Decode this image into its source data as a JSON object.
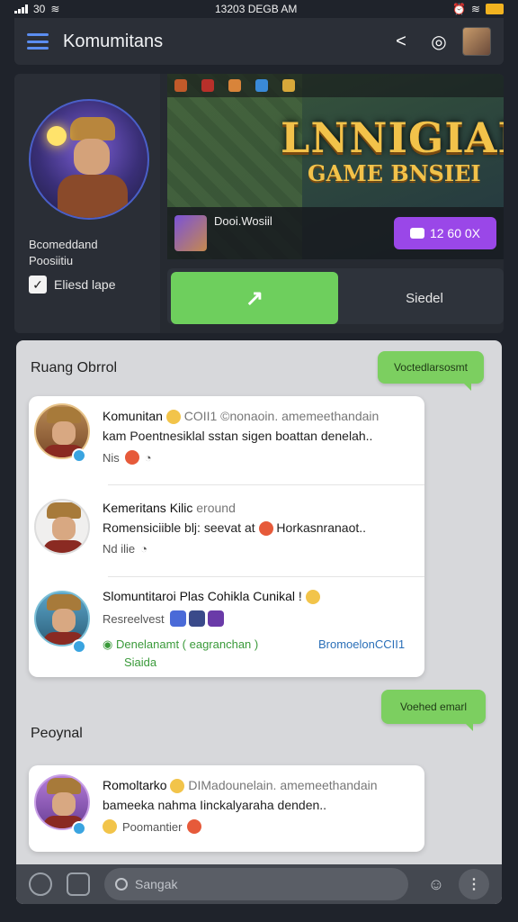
{
  "status_bar": {
    "signal": "30",
    "time": "13203 DEGB AM"
  },
  "app_bar": {
    "title": "Komumitans",
    "share_icon": "share-icon",
    "settings_icon": "settings-icon"
  },
  "profile": {
    "name_line1": "Bcomeddand",
    "name_line2": "Poosiitiu",
    "checkbox_label": "Eliesd lape"
  },
  "banner": {
    "title": "LNNIGIAN",
    "subtitle": "GAME BNSIEI"
  },
  "live": {
    "streamer": "Dooi.Wosiil",
    "viewers": "12 60  0X"
  },
  "actions": {
    "primary_glyph": "↗",
    "secondary_label": "Siedel"
  },
  "chat": {
    "section1_title": "Ruang Obrrol",
    "bubble1": "Voctedlarsosmt",
    "messages": [
      {
        "name": "Komunitan",
        "preview": "COII1 ©nonaoin. amemeethandain",
        "text": "kam Poentnesiklal sstan sigen boattan denelah..",
        "meta": "Nis"
      },
      {
        "name": "Kemeritans Kilic",
        "preview": "eround",
        "text": "Romensiciible blj: seevat at",
        "text_tail": "Horkasnranaot..",
        "meta": "Nd ilie"
      },
      {
        "name": "Slomuntitaroi Plas Cohikla Cunikal !",
        "preview": "",
        "text": "Resreelvest",
        "link_green_1": "Denelanamt ( eagranchan )",
        "link_green_2": "Siaida",
        "link_blue": "BromoelonCCII1"
      }
    ],
    "bubble2": "Voehed emarl",
    "section2_title": "Peoynal",
    "message4": {
      "name": "Romoltarko",
      "preview": "DIMadounelain. amemeethandain",
      "text": "bameeka nahma Iinckalyaraha denden..",
      "meta": "Poomantier"
    }
  },
  "bottom_bar": {
    "search_placeholder": "Sangak"
  },
  "colors": {
    "accent_green": "#6ecf5d",
    "accent_purple": "#9a47e8",
    "link_blue": "#2a6fb8"
  }
}
